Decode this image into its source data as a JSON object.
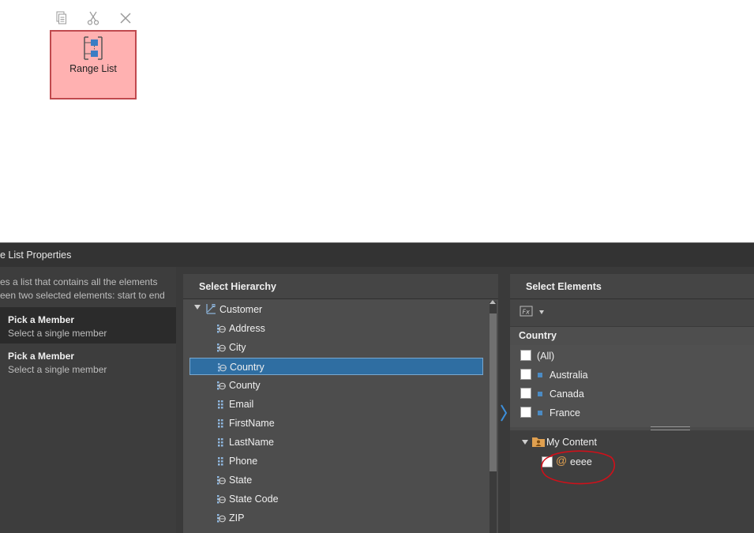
{
  "toolbar": {
    "copy_icon": "copy-icon",
    "cut_icon": "scissors-icon",
    "close_icon": "close-icon"
  },
  "tile": {
    "label": "Range List",
    "icon": "range-list-icon",
    "background": "#ffb1b1",
    "border": "#c0494e"
  },
  "panel": {
    "title": "e List Properties",
    "description_line1": "es a list that contains all the elements",
    "description_line2": "een two selected elements: start to end",
    "members": [
      {
        "title": "Pick a Member",
        "subtitle": "Select a single member",
        "selected": true
      },
      {
        "title": "Pick a Member",
        "subtitle": "Select a single member",
        "selected": false
      }
    ]
  },
  "hierarchy": {
    "header": "Select Hierarchy",
    "root": "Customer",
    "levels": [
      "Address",
      "City",
      "Country",
      "County",
      "Email",
      "FirstName",
      "LastName",
      "Phone",
      "State",
      "State Code",
      "ZIP"
    ],
    "selected": "Country",
    "selection_color": "#2f6ea2"
  },
  "elements": {
    "header": "Select Elements",
    "fx_icon": "fx-icon",
    "level_name": "Country",
    "items": [
      "(All)",
      "Australia",
      "Canada",
      "France"
    ],
    "my_content": "My Content",
    "content_item": "eeee",
    "annotation_color": "#d0101a"
  }
}
